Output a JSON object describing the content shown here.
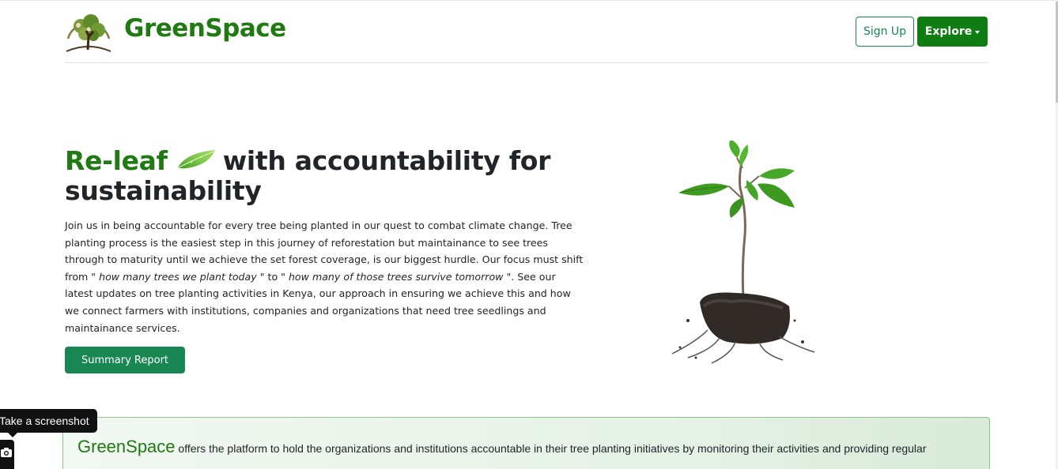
{
  "header": {
    "brand": "GreenSpace",
    "signup_label": "Sign Up",
    "explore_label": "Explore",
    "logo_icon": "tree-logo-icon"
  },
  "hero": {
    "title_accent": "Re-leaf",
    "title_rest": "with accountability for sustainability",
    "leaf_icon": "leaf-icon",
    "para_part1": "Join us in being accountable for every tree being planted in our quest to combat climate change. Tree planting process is the easiest step in this journey of reforestation but maintainance to see trees through to maturity until we achieve the set forest coverage, is our biggest hurdle. Our focus must shift from \" ",
    "para_em1": "how many trees we plant today",
    "para_part2": " \" to \" ",
    "para_em2": "how many of those trees survive tomorrow",
    "para_part3": " \". See our latest updates on tree planting activities in Kenya, our approach in ensuring we achieve this and how we connect farmers with institutions, companies and organizations that need tree seedlings and maintainance services.",
    "summary_button": "Summary Report",
    "image_icon": "seedling-image"
  },
  "info": {
    "brand": "GreenSpace",
    "text": " offers the platform to hold the organizations and institutions accountable in their tree planting initiatives by monitoring their activities and providing regular"
  },
  "widget": {
    "tooltip": "Take a screenshot",
    "camera_icon": "camera-icon"
  },
  "colors": {
    "brand_green": "#1f7a12",
    "button_green": "#198754",
    "explore_green": "#0f7d12"
  }
}
